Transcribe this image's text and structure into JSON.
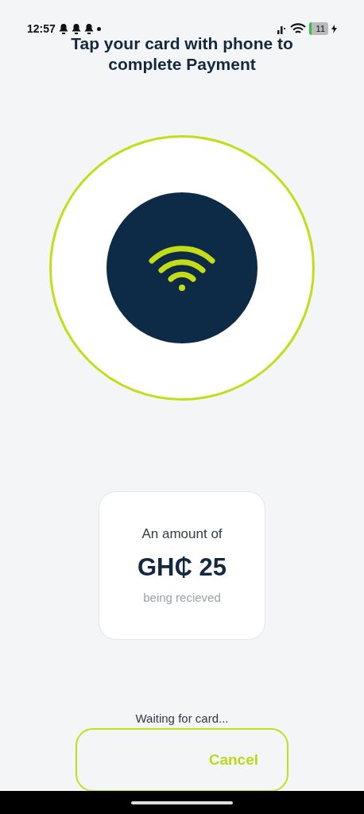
{
  "status_bar": {
    "time": "12:57",
    "battery": "11",
    "charging": true
  },
  "title": "Tap your card with phone to complete Payment",
  "amount_card": {
    "label": "An amount of",
    "amount": "GH₵ 25",
    "caption": "being recieved"
  },
  "status_text": "Waiting for card...",
  "buttons": [
    {
      "label": "Cancel"
    }
  ]
}
